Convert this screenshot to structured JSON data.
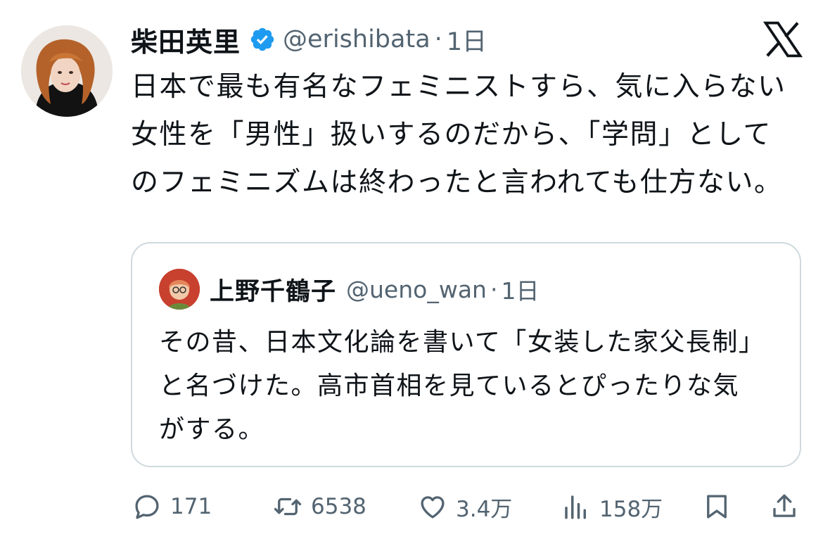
{
  "tweet": {
    "author_name": "柴田英里",
    "handle": "@erishibata",
    "separator": "·",
    "time": "1日",
    "text": "日本で最も有名なフェミニストすら、気に入らない女性を「男性」扱いするのだから、「学問」としてのフェミニズムは終わったと言われても仕方ない。",
    "avatar_icon": "user-avatar",
    "verified_icon": "verified-badge-icon",
    "logo_icon": "x-logo-icon"
  },
  "quote": {
    "author_name": "上野千鶴子",
    "handle": "@ueno_wan",
    "separator": "·",
    "time": "1日",
    "text": "その昔、日本文化論を書いて「女装した家父長制」と名づけた。高市首相を見ているとぴったりな気がする。"
  },
  "actions": {
    "reply_count": "171",
    "repost_count": "6538",
    "like_count": "3.4万",
    "view_count": "158万",
    "icons": [
      "reply-icon",
      "repost-icon",
      "like-icon",
      "views-icon",
      "bookmark-icon",
      "share-icon"
    ]
  },
  "colors": {
    "text": "#0f1419",
    "secondary": "#536471",
    "verified": "#1d9bf0",
    "border": "#cfd9de"
  }
}
